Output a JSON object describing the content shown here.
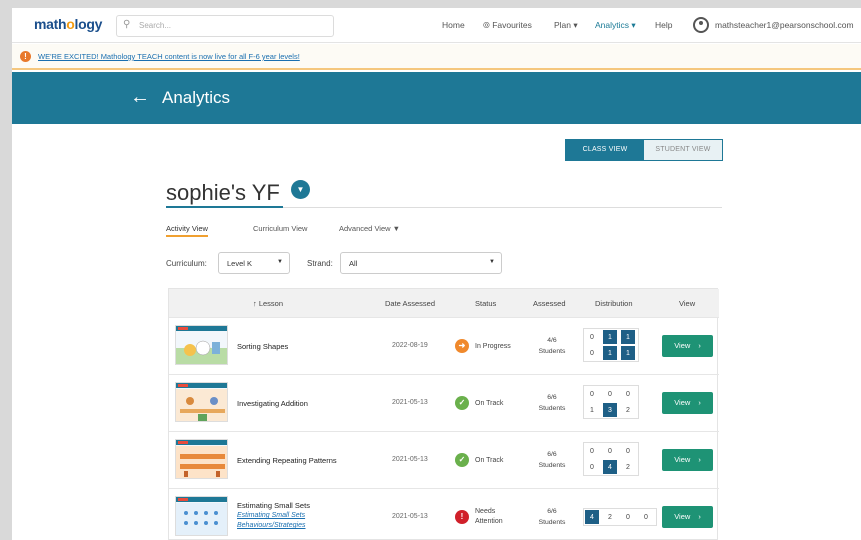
{
  "header": {
    "logo": "mathology",
    "search_placeholder": "Search...",
    "nav": [
      "Home",
      "Favourites",
      "Plan",
      "Analytics",
      "Help"
    ],
    "email": "mathsteacher1@pearsonschool.com"
  },
  "banner": {
    "text": "WE'RE EXCITED! Mathology TEACH content is now live for all F-6 year levels!"
  },
  "page": {
    "title": "Analytics",
    "class_view": "CLASS VIEW",
    "student_view": "STUDENT VIEW",
    "class_name": "sophie's YF",
    "subtabs": [
      "Activity View",
      "Curriculum View",
      "Advanced View"
    ],
    "curriculum_label": "Curriculum:",
    "curriculum_value": "Level K",
    "strand_label": "Strand:",
    "strand_value": "All"
  },
  "table": {
    "headers": [
      "Lesson",
      "Date Assessed",
      "Status",
      "Assessed",
      "Distribution",
      "View"
    ],
    "rows": [
      {
        "lesson": "Sorting Shapes",
        "sub": "",
        "date": "2022-08-19",
        "status": "In Progress",
        "status_color": "#f0892c",
        "assessed": "4/6",
        "assessed_sub": "Students",
        "dist": [
          "0",
          "1",
          "1",
          "0",
          "1",
          "1"
        ],
        "filled": [
          false,
          true,
          true,
          false,
          true,
          true
        ],
        "view": "View"
      },
      {
        "lesson": "Investigating Addition",
        "sub": "",
        "date": "2021-05-13",
        "status": "On Track",
        "status_color": "#6ab04c",
        "assessed": "6/6",
        "assessed_sub": "Students",
        "dist": [
          "0",
          "0",
          "0",
          "1",
          "3",
          "2"
        ],
        "filled": [
          false,
          false,
          false,
          false,
          true,
          false
        ],
        "view": "View"
      },
      {
        "lesson": "Extending Repeating Patterns",
        "sub": "",
        "date": "2021-05-13",
        "status": "On Track",
        "status_color": "#6ab04c",
        "assessed": "6/6",
        "assessed_sub": "Students",
        "dist": [
          "0",
          "0",
          "0",
          "0",
          "4",
          "2"
        ],
        "filled": [
          false,
          false,
          false,
          false,
          true,
          false
        ],
        "view": "View"
      },
      {
        "lesson": "Estimating Small Sets",
        "sub": "Estimating Small Sets Behaviours/Strategies",
        "date": "2021-05-13",
        "status": "Needs Attention",
        "status_color": "#d0202a",
        "assessed": "6/6",
        "assessed_sub": "Students",
        "dist": [
          "4",
          "2",
          "0",
          "0"
        ],
        "filled": [
          true,
          false,
          false,
          false
        ],
        "view": "View"
      }
    ]
  },
  "icons": {
    "search": "search-icon",
    "favourite": "star-circle-icon",
    "alert": "alert-icon",
    "back": "arrow-left-icon",
    "user": "user-circle-icon"
  }
}
